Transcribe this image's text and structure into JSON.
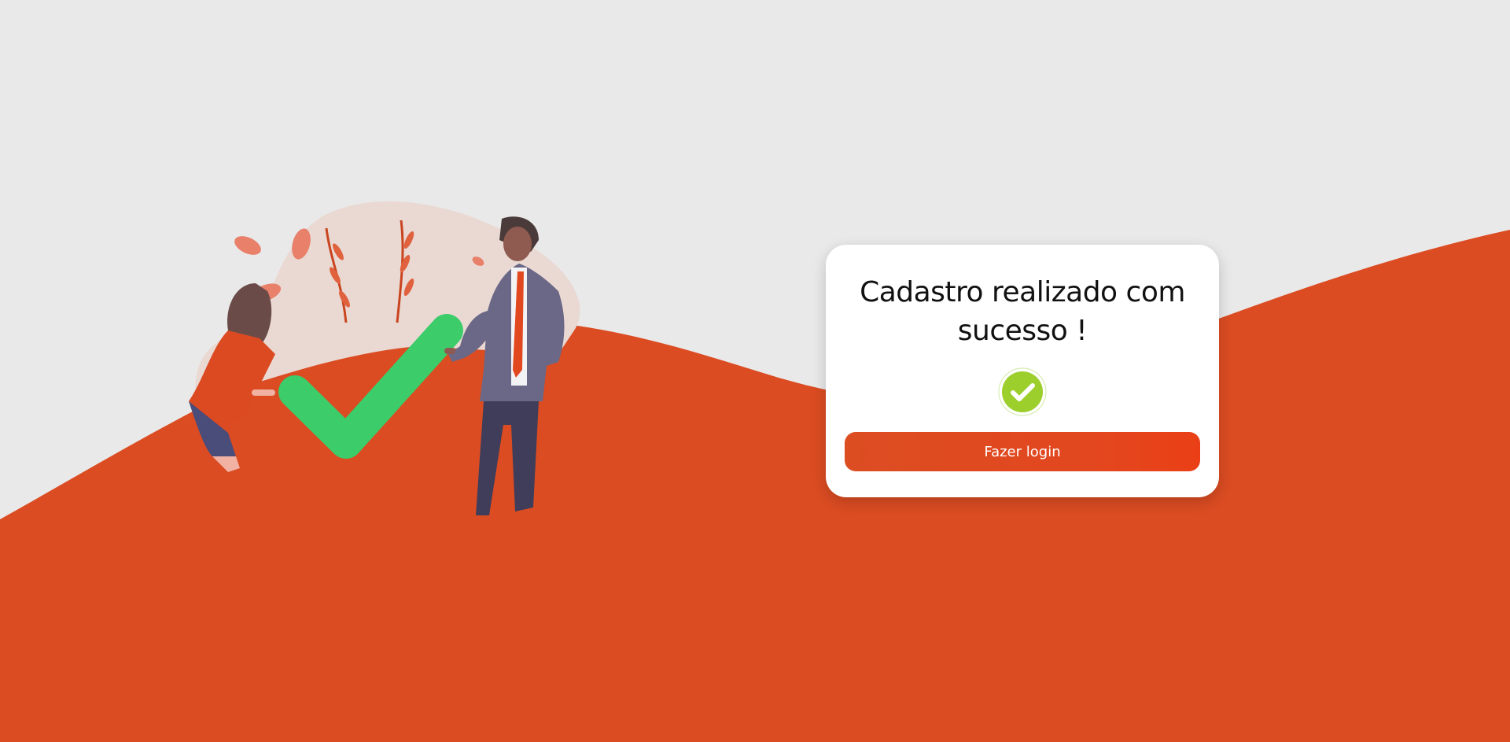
{
  "colors": {
    "background": "#e9e9e9",
    "wave": "#db4c22",
    "card": "#ffffff",
    "button": "#e2481f",
    "check_green": "#3ccc6a",
    "icon_green": "#9ccf2b"
  },
  "card": {
    "title": "Cadastro realizado com sucesso !",
    "icon": "check-circle-icon",
    "button_label": "Fazer login"
  },
  "illustration": {
    "icon": "success-illustration"
  }
}
